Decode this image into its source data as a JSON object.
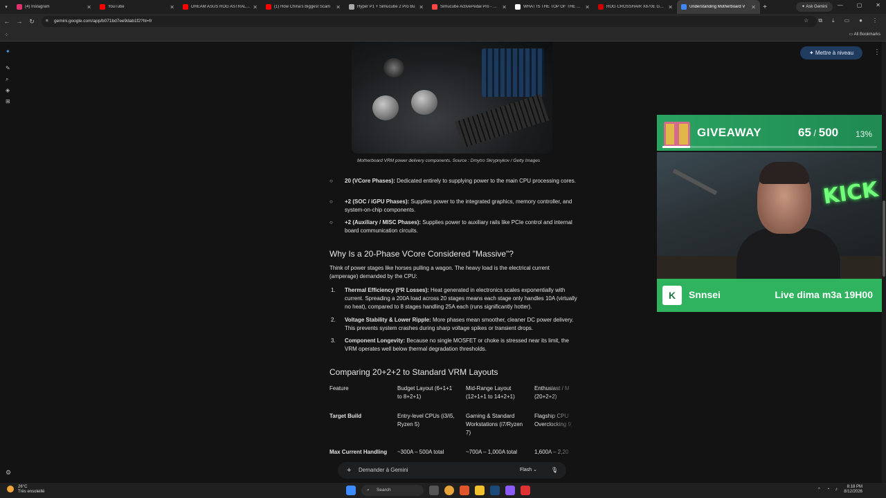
{
  "browser": {
    "tabs": [
      {
        "label": "(4) Instagram",
        "color": "#e1306c"
      },
      {
        "label": "YouTube",
        "color": "#ff0000"
      },
      {
        "label": "DREAM ASUS ROG ASTRAL RTX",
        "color": "#ff0000"
      },
      {
        "label": "(1) How China's Biggest Scam",
        "color": "#ff0000"
      },
      {
        "label": "Hyper P1 + Simucube 2 Pro Bu",
        "color": "#aaaaaa"
      },
      {
        "label": "Simucube ActivePedal Pro - Adv",
        "color": "#ff4444"
      },
      {
        "label": "WHAT IS THE TOP OF THE LINE",
        "color": "#ffffff"
      },
      {
        "label": "ROG CROSSHAIR X870E GLACI",
        "color": "#cc0000"
      },
      {
        "label": "Understanding Motherboard V",
        "color": "#4285f4",
        "active": true
      }
    ],
    "ask_gemini": "Ask Gemini",
    "url": "gemini.google.com/app/b071bd7ee9dab1f2?hl=fr",
    "all_bookmarks": "All Bookmarks"
  },
  "gemini": {
    "upgrade_button": "Mettre à niveau",
    "image_caption": "Motherboard VRM power delivery components. Source  : Dmytro Skrypnykov / Getty Images",
    "bullets": [
      {
        "bold": "20 (VCore Phases):",
        "text": " Dedicated entirely to supplying power to the main CPU processing cores."
      },
      {
        "bold": "+2 (SOC / iGPU Phases):",
        "text": " Supplies power to the integrated graphics, memory controller, and system-on-chip components."
      },
      {
        "bold": "+2 (Auxiliary / MISC Phases):",
        "text": " Supplies power to auxiliary rails like PCIe control and internal board communication circuits."
      }
    ],
    "heading1": "Why Is a 20-Phase VCore Considered \"Massive\"?",
    "intro": "Think of power stages like horses pulling a wagon. The heavy load is the electrical current (amperage) demanded by the CPU:",
    "numbered": [
      {
        "n": "1.",
        "bold": "Thermal Efficiency (I²R Losses):",
        "text": " Heat generated in electronics scales exponentially with current. Spreading a 200A load across 20 stages means each stage only handles 10A (virtually no heat), compared to 8 stages handling 25A each (runs significantly hotter)."
      },
      {
        "n": "2.",
        "bold": "Voltage Stability & Lower Ripple:",
        "text": " More phases mean smoother, cleaner DC power delivery. This prevents system crashes during sharp voltage spikes or transient drops."
      },
      {
        "n": "3.",
        "bold": "Component Longevity:",
        "text": " Because no single MOSFET or choke is stressed near its limit, the VRM operates well below thermal degradation thresholds."
      }
    ],
    "heading2": "Comparing 20+2+2 to Standard VRM Layouts",
    "table": {
      "headers": [
        "Feature",
        "Budget Layout (6+1+1 to 8+2+1)",
        "Mid-Range Layout (12+1+1 to 14+2+1)",
        "Enthusiast / M (20+2+2)"
      ],
      "rows": [
        [
          "Target Build",
          "Entry-level CPUs (i3/i5, Ryzen 5)",
          "Gaming & Standard Workstations (i7/Ryzen 7)",
          "Flagship CPU Overclocking 9)"
        ],
        [
          "Max Current Handling",
          "~300A – 500A total",
          "~700A – 1,000A total",
          "1,600A – 2,20"
        ]
      ]
    },
    "input_placeholder": "Demander à Gemini",
    "mode": "Flash"
  },
  "overlay": {
    "giveaway_title": "GIVEAWAY",
    "count": "65",
    "total": "500",
    "percent": "13%",
    "progress": 0.13,
    "neon_text": "KICK",
    "streamer": "Snnsei",
    "live_text": "Live dima m3a 19H00",
    "kick_logo": "K"
  },
  "taskbar": {
    "temp": "26°C",
    "weather": "Très ensoleillé",
    "search": "Search",
    "time": "8:18 PM",
    "date": "8/12/2026"
  }
}
